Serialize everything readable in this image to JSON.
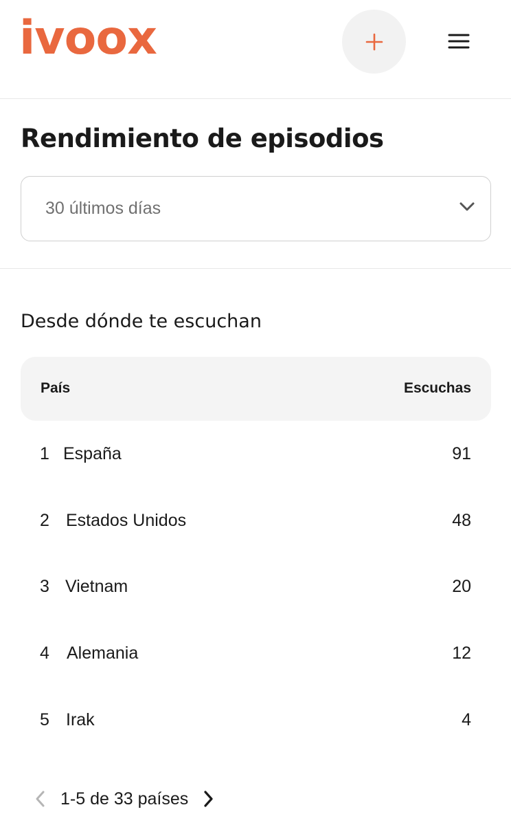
{
  "header": {
    "logo": "ivoox",
    "add_icon": "plus-icon",
    "menu_icon": "hamburger-menu-icon"
  },
  "colors": {
    "brand": "#e9683f",
    "text": "#1a1a1a",
    "muted": "#707070"
  },
  "main": {
    "title": "Rendimiento de episodios",
    "period_select": {
      "value": "30 últimos días",
      "icon": "chevron-down-icon"
    }
  },
  "countries": {
    "title": "Desde dónde te escuchan",
    "columns": {
      "country": "País",
      "listens": "Escuchas"
    },
    "rows": [
      {
        "rank": "1",
        "name": "España",
        "listens": "91"
      },
      {
        "rank": "2",
        "name": "Estados Unidos",
        "listens": "48"
      },
      {
        "rank": "3",
        "name": "Vietnam",
        "listens": "20"
      },
      {
        "rank": "4",
        "name": "Alemania",
        "listens": "12"
      },
      {
        "rank": "5",
        "name": "Irak",
        "listens": "4"
      }
    ],
    "pagination": {
      "label": "1-5 de 33 países",
      "prev_icon": "chevron-left-icon",
      "next_icon": "chevron-right-icon"
    }
  }
}
